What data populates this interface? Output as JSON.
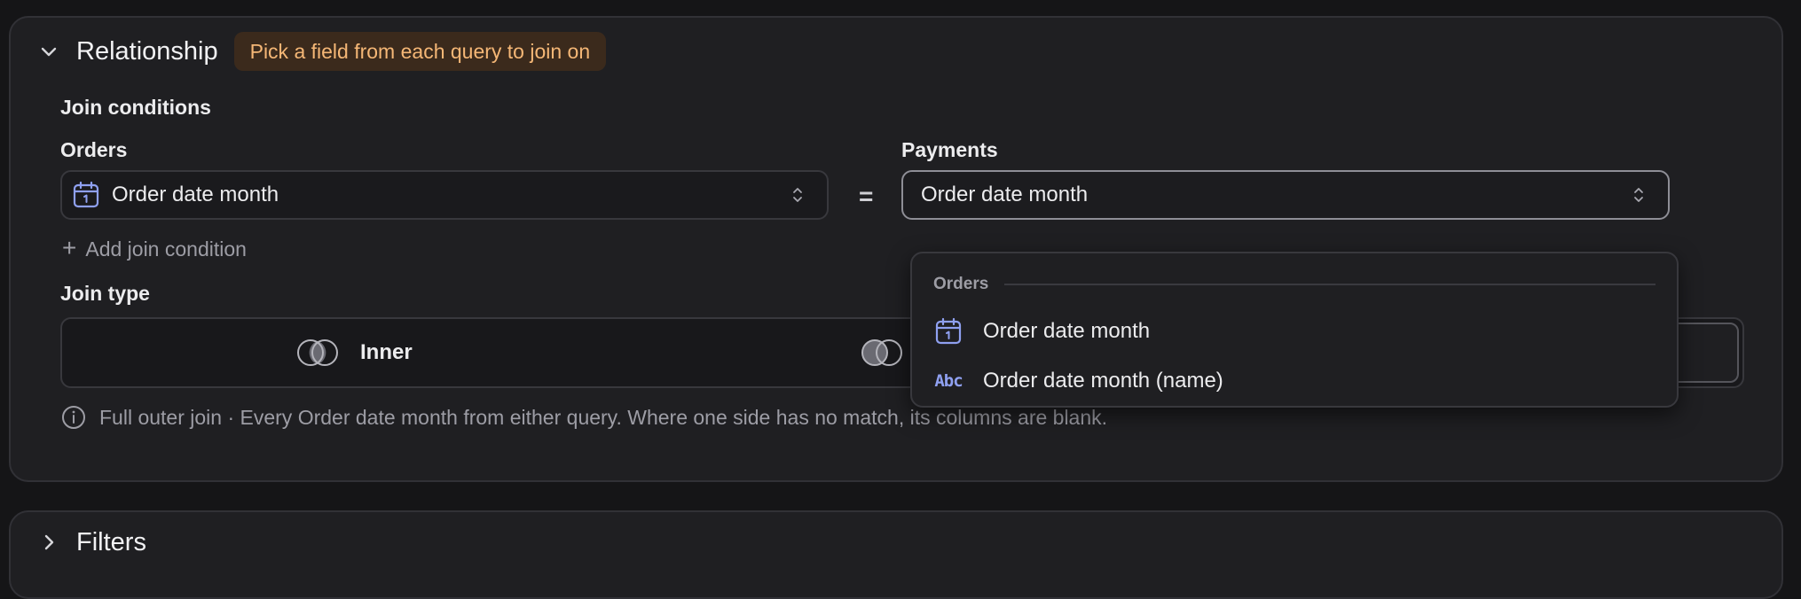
{
  "relationship": {
    "title": "Relationship",
    "badge": "Pick a field from each query to join on",
    "join_conditions_label": "Join conditions",
    "left": {
      "query_label": "Orders",
      "selected_field": "Order date month",
      "field_icon": "calendar-icon"
    },
    "operator": "=",
    "right": {
      "query_label": "Payments",
      "selected_field": "Order date month"
    },
    "add_condition_label": "Add join condition",
    "join_type_label": "Join type",
    "join_types": [
      {
        "label": "Inner",
        "icon": "venn-inner-icon"
      },
      {
        "label": "",
        "icon": "venn-left-icon"
      }
    ],
    "info_text": "Full outer join · Every Order date month from either query. Where one side has no match, its columns are blank."
  },
  "dropdown": {
    "group_label": "Orders",
    "items": [
      {
        "label": "Order date month",
        "icon": "calendar-icon"
      },
      {
        "label": "Order date month (name)",
        "icon": "abc-text-icon",
        "icon_text": "Abc"
      }
    ]
  },
  "filters": {
    "title": "Filters"
  },
  "colors": {
    "accent_icon": "#8fa0f0",
    "badge_bg": "#3b2a1c",
    "badge_text": "#f5b776",
    "panel_bg": "#1f1f22",
    "page_bg": "#151517"
  }
}
